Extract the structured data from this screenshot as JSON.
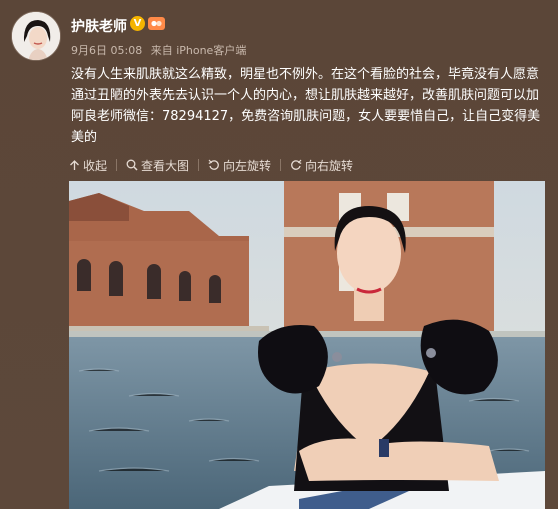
{
  "post": {
    "username": "护肤老师",
    "verified_badge": "V",
    "date": "9月6日 05:08",
    "source": "来自 iPhone客户端",
    "text": "没有人生来肌肤就这么精致，明星也不例外。在这个看脸的社会，毕竟没有人愿意通过丑陋的外表先去认识一个人的内心，想让肌肤越来越好，改善肌肤问题可以加阿良老师微信：78294127，免费咨询肌肤问题，女人要要惜自己，让自己变得美美的"
  },
  "toolbar": {
    "collapse": "收起",
    "view_large": "查看大图",
    "rotate_left": "向左旋转",
    "rotate_right": "向右旋转"
  },
  "colors": {
    "background": "#5a4538",
    "badge": "#f5b400",
    "text": "#ffffff",
    "meta": "#c9b9ad"
  },
  "icons": [
    "collapse-icon",
    "zoom-icon",
    "rotate-left-icon",
    "rotate-right-icon"
  ]
}
